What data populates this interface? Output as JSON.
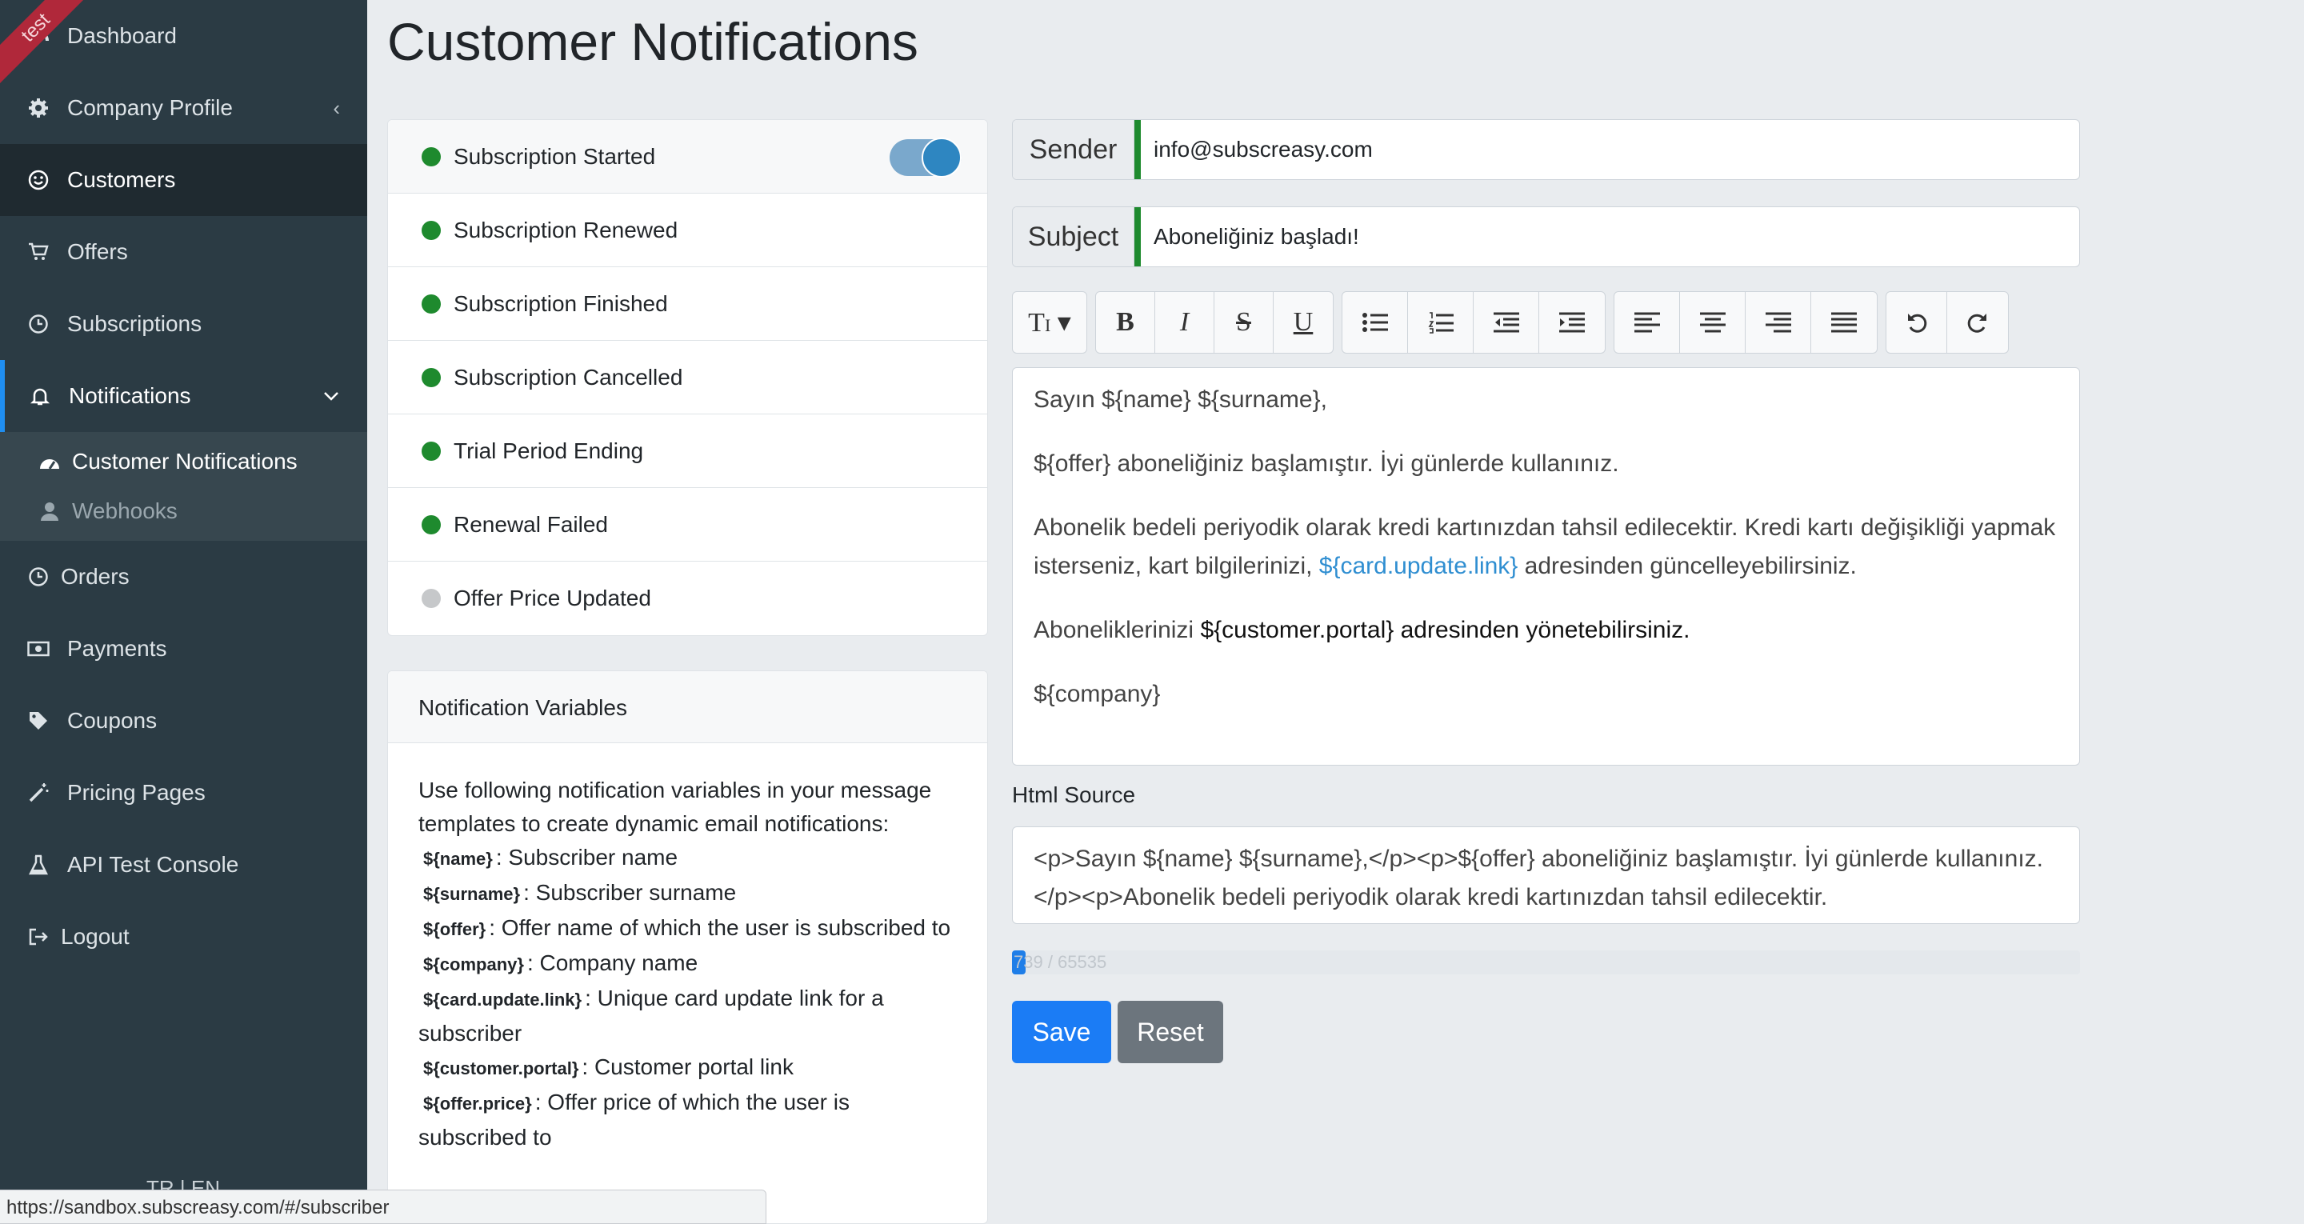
{
  "sidebar": {
    "ribbon": "test",
    "items": [
      {
        "label": "Dashboard",
        "icon": "dashboard-icon"
      },
      {
        "label": "Company Profile",
        "icon": "gear-icon"
      },
      {
        "label": "Customers",
        "icon": "smile-icon"
      },
      {
        "label": "Offers",
        "icon": "cart-icon"
      },
      {
        "label": "Subscriptions",
        "icon": "clock-icon"
      },
      {
        "label": "Notifications",
        "icon": "bell-icon"
      },
      {
        "label": "Orders",
        "icon": "clock-icon"
      },
      {
        "label": "Payments",
        "icon": "money-icon"
      },
      {
        "label": "Coupons",
        "icon": "tag-icon"
      },
      {
        "label": "Pricing Pages",
        "icon": "wand-icon"
      },
      {
        "label": "API Test Console",
        "icon": "flask-icon"
      },
      {
        "label": "Logout",
        "icon": "sign-out-icon"
      }
    ],
    "submenu": [
      {
        "label": "Customer Notifications",
        "icon": "dashboard-icon"
      },
      {
        "label": "Webhooks",
        "icon": "user-icon"
      }
    ],
    "lang": "TR | EN"
  },
  "status_url": "https://sandbox.subscreasy.com/#/subscriber",
  "page": {
    "title": "Customer Notifications"
  },
  "events": [
    {
      "label": "Subscription Started",
      "enabled": true
    },
    {
      "label": "Subscription Renewed",
      "enabled": true
    },
    {
      "label": "Subscription Finished",
      "enabled": true
    },
    {
      "label": "Subscription Cancelled",
      "enabled": true
    },
    {
      "label": "Trial Period Ending",
      "enabled": true
    },
    {
      "label": "Renewal Failed",
      "enabled": true
    },
    {
      "label": "Offer Price Updated",
      "enabled": false
    }
  ],
  "variables": {
    "title": "Notification Variables",
    "intro": "Use following notification variables in your message templates to create dynamic email notifications:",
    "items": [
      {
        "name": "${name}",
        "desc": ": Subscriber name"
      },
      {
        "name": "${surname}",
        "desc": ": Subscriber surname"
      },
      {
        "name": "${offer}",
        "desc": ": Offer name of which the user is subscribed to"
      },
      {
        "name": "${company}",
        "desc": ": Company name"
      },
      {
        "name": "${card.update.link}",
        "desc": ": Unique card update link for a subscriber"
      },
      {
        "name": "${customer.portal}",
        "desc": ": Customer portal link"
      },
      {
        "name": "${offer.price}",
        "desc": ": Offer price of which the user is subscribed to"
      }
    ]
  },
  "form": {
    "sender_label": "Sender",
    "sender_value": "info@subscreasy.com",
    "subject_label": "Subject",
    "subject_value": "Aboneliğiniz başladı!"
  },
  "editor": {
    "line1": "Sayın ${name} ${surname},",
    "line2": "${offer} aboneliğiniz başlamıştır. İyi günlerde kullanınız.",
    "line3a": "Abonelik bedeli periyodik olarak kredi kartınızdan tahsil edilecektir. Kredi kartı değişikliği yapmak isterseniz, kart bilgilerinizi, ",
    "line3link": "${card.update.link}",
    "line3b": " adresinden güncelleyebilirsiniz.",
    "line4a": "Aboneliklerinizi ",
    "line4var": "${customer.portal}",
    "line4b": " adresinden yönetebilirsiniz.",
    "line5": "${company}"
  },
  "html_source": {
    "label": "Html Source",
    "value": "<p>Sayın ${name} ${surname},</p><p>${offer} aboneliğiniz başlamıştır. İyi günlerde kullanınız.</p><p>Abonelik bedeli periyodik olarak kredi kartınızdan tahsil edilecektir."
  },
  "counter": {
    "text": "739 / 65535",
    "fraction": 0.011
  },
  "buttons": {
    "save": "Save",
    "reset": "Reset"
  },
  "colors": {
    "accent": "#1b7cf5",
    "sidebar": "#2b3b44",
    "enabled": "#1e8a2e",
    "disabled": "#c6c8ca"
  }
}
